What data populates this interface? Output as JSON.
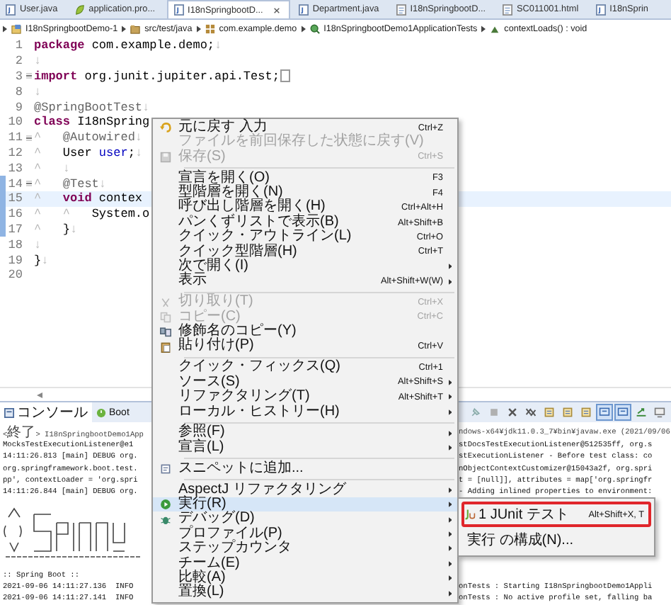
{
  "editor_tabs": [
    {
      "label": "User.java",
      "kind": "java",
      "selected": false
    },
    {
      "label": "application.pro...",
      "kind": "properties",
      "selected": false
    },
    {
      "label": "I18nSpringbootD...",
      "kind": "java",
      "selected": true
    },
    {
      "label": "Department.java",
      "kind": "java",
      "selected": false
    },
    {
      "label": "I18nSpringbootD...",
      "kind": "html",
      "selected": false
    },
    {
      "label": "SC011001.html",
      "kind": "html",
      "selected": false
    },
    {
      "label": "I18nSprin",
      "kind": "java",
      "selected": false
    }
  ],
  "breadcrumb": [
    {
      "label": "I18nSpringbootDemo-1",
      "kind": "project"
    },
    {
      "label": "src/test/java",
      "kind": "folder"
    },
    {
      "label": "com.example.demo",
      "kind": "package"
    },
    {
      "label": "I18nSpringbootDemo1ApplicationTests",
      "kind": "class"
    },
    {
      "label": "contextLoads() : void",
      "kind": "method"
    }
  ],
  "code_lines": [
    {
      "number": "1",
      "fold": false,
      "marked": false,
      "current": false,
      "collapsed": false,
      "tokens": [
        {
          "kind": "keyword",
          "text": "package"
        },
        {
          "kind": "plain",
          "text": " com.example.demo;"
        },
        {
          "kind": "whitespace",
          "text": "↓"
        }
      ]
    },
    {
      "number": "2",
      "fold": false,
      "marked": false,
      "current": false,
      "collapsed": false,
      "tokens": [
        {
          "kind": "whitespace",
          "text": "↓"
        }
      ]
    },
    {
      "number": "3",
      "fold": true,
      "marked": false,
      "current": false,
      "collapsed": true,
      "tokens": [
        {
          "kind": "keyword",
          "text": "import"
        },
        {
          "kind": "plain",
          "text": " org.junit.jupiter.api.Test;"
        }
      ]
    },
    {
      "number": "8",
      "fold": false,
      "marked": false,
      "current": false,
      "collapsed": false,
      "tokens": [
        {
          "kind": "whitespace",
          "text": "↓"
        }
      ]
    },
    {
      "number": "9",
      "fold": false,
      "marked": false,
      "current": false,
      "collapsed": false,
      "tokens": [
        {
          "kind": "annotation",
          "text": "@SpringBootTest"
        },
        {
          "kind": "whitespace",
          "text": "↓"
        }
      ]
    },
    {
      "number": "10",
      "fold": false,
      "marked": false,
      "current": false,
      "collapsed": false,
      "tokens": [
        {
          "kind": "keyword",
          "text": "class"
        },
        {
          "kind": "plain",
          "text": " I18nSpring"
        }
      ]
    },
    {
      "number": "11",
      "fold": true,
      "marked": false,
      "current": false,
      "collapsed": false,
      "tokens": [
        {
          "kind": "whitespace",
          "text": "^   "
        },
        {
          "kind": "annotation",
          "text": "@Autowired"
        },
        {
          "kind": "whitespace",
          "text": "↓"
        }
      ]
    },
    {
      "number": "12",
      "fold": false,
      "marked": false,
      "current": false,
      "collapsed": false,
      "tokens": [
        {
          "kind": "whitespace",
          "text": "^   "
        },
        {
          "kind": "plain",
          "text": "User "
        },
        {
          "kind": "field",
          "text": "user"
        },
        {
          "kind": "plain",
          "text": ";"
        },
        {
          "kind": "whitespace",
          "text": "↓"
        }
      ]
    },
    {
      "number": "13",
      "fold": false,
      "marked": false,
      "current": false,
      "collapsed": false,
      "tokens": [
        {
          "kind": "whitespace",
          "text": "^   ↓"
        }
      ]
    },
    {
      "number": "14",
      "fold": true,
      "marked": true,
      "current": false,
      "collapsed": false,
      "tokens": [
        {
          "kind": "whitespace",
          "text": "^   "
        },
        {
          "kind": "annotation",
          "text": "@Test"
        },
        {
          "kind": "whitespace",
          "text": "↓"
        }
      ]
    },
    {
      "number": "15",
      "fold": false,
      "marked": true,
      "current": true,
      "collapsed": false,
      "tokens": [
        {
          "kind": "whitespace",
          "text": "^   "
        },
        {
          "kind": "keyword",
          "text": "void"
        },
        {
          "kind": "plain",
          "text": " contex"
        }
      ]
    },
    {
      "number": "16",
      "fold": false,
      "marked": true,
      "current": false,
      "collapsed": false,
      "tokens": [
        {
          "kind": "whitespace",
          "text": "^   ^   "
        },
        {
          "kind": "plain",
          "text": "System.o"
        }
      ]
    },
    {
      "number": "17",
      "fold": false,
      "marked": true,
      "current": false,
      "collapsed": false,
      "tokens": [
        {
          "kind": "whitespace",
          "text": "^   "
        },
        {
          "kind": "plain",
          "text": "}"
        },
        {
          "kind": "whitespace",
          "text": "↓"
        }
      ]
    },
    {
      "number": "18",
      "fold": false,
      "marked": false,
      "current": false,
      "collapsed": false,
      "tokens": [
        {
          "kind": "whitespace",
          "text": "↓"
        }
      ]
    },
    {
      "number": "19",
      "fold": false,
      "marked": false,
      "current": false,
      "collapsed": false,
      "tokens": [
        {
          "kind": "plain",
          "text": "}"
        },
        {
          "kind": "whitespace",
          "text": "↓"
        }
      ]
    },
    {
      "number": "20",
      "fold": false,
      "marked": false,
      "current": false,
      "collapsed": false
    }
  ],
  "console": {
    "tabs": [
      {
        "label": "コンソール",
        "kind": "console",
        "selected": true
      },
      {
        "label": "Boot",
        "kind": "boot",
        "selected": false
      }
    ],
    "toolbar": [
      {
        "kind": "pin",
        "pressed": false
      },
      {
        "kind": "stop",
        "pressed": false
      },
      {
        "kind": "remove",
        "pressed": false
      },
      {
        "kind": "remove-all",
        "pressed": false
      },
      {
        "kind": "page",
        "pressed": false
      },
      {
        "kind": "page",
        "pressed": false
      },
      {
        "kind": "page",
        "pressed": false
      },
      {
        "kind": "display",
        "pressed": true
      },
      {
        "kind": "display",
        "pressed": true
      },
      {
        "kind": "open",
        "pressed": false
      },
      {
        "kind": "monitor",
        "pressed": false
      }
    ],
    "lines": [
      {
        "kind": "header",
        "left": "<終了> I18nSpringbootDemo1App",
        "right": "ndows-x64¥jdk11.0.3_7¥bin¥javaw.exe (2021/09/06"
      },
      {
        "kind": "text",
        "left": "MocksTestExecutionListener@e1",
        "right": "stDocsTestExecutionListener@512535ff, org.s"
      },
      {
        "kind": "text",
        "left": "14:11:26.813 [main] DEBUG org.",
        "right": "stExecutionListener - Before test class: co"
      },
      {
        "kind": "text",
        "left": "org.springframework.boot.test.",
        "right": "nObjectContextCustomizer@15043a2f, org.spri"
      },
      {
        "kind": "text",
        "left": "pp', contextLoader = 'org.spri",
        "right": "t = [null]], attributes = map['org.springfr"
      },
      {
        "kind": "text",
        "left": "14:11:26.844 [main] DEBUG org.",
        "right": "- Adding inlined properties to environment:"
      },
      {
        "kind": "banner"
      },
      {
        "kind": "text",
        "left": ":: Spring Boot ::"
      },
      {
        "kind": "text",
        "left": "2021-09-06 14:11:27.136  INFO",
        "right": "onTests : Starting I18nSpringbootDemo1Appli"
      },
      {
        "kind": "text",
        "left": "2021-09-06 14:11:27.141  INFO",
        "right": "onTests : No active profile set, falling ba"
      }
    ]
  },
  "context_menu": {
    "items": [
      {
        "kind": "item",
        "label": "元に戻す 入力",
        "shortcut": "Ctrl+Z",
        "disabled": false,
        "submenu": false,
        "selected": false
      },
      {
        "kind": "item",
        "label": "ファイルを前回保存した状態に戻す(V)",
        "disabled": true,
        "submenu": false,
        "selected": false
      },
      {
        "kind": "item",
        "label": "保存(S)",
        "shortcut": "Ctrl+S",
        "disabled": true,
        "submenu": false,
        "selected": false
      },
      {
        "kind": "separator"
      },
      {
        "kind": "item",
        "label": "宣言を開く(O)",
        "shortcut": "F3",
        "disabled": false,
        "submenu": false,
        "selected": false
      },
      {
        "kind": "item",
        "label": "型階層を開く(N)",
        "shortcut": "F4",
        "disabled": false,
        "submenu": false,
        "selected": false
      },
      {
        "kind": "item",
        "label": "呼び出し階層を開く(H)",
        "shortcut": "Ctrl+Alt+H",
        "disabled": false,
        "submenu": false,
        "selected": false
      },
      {
        "kind": "item",
        "label": "パンくずリストで表示(B)",
        "shortcut": "Alt+Shift+B",
        "disabled": false,
        "submenu": false,
        "selected": false
      },
      {
        "kind": "item",
        "label": "クイック・アウトライン(L)",
        "shortcut": "Ctrl+O",
        "disabled": false,
        "submenu": false,
        "selected": false
      },
      {
        "kind": "item",
        "label": "クイック型階層(H)",
        "shortcut": "Ctrl+T",
        "disabled": false,
        "submenu": false,
        "selected": false
      },
      {
        "kind": "item",
        "label": "次で開く(I)",
        "disabled": false,
        "submenu": true,
        "selected": false
      },
      {
        "kind": "item",
        "label": "表示",
        "shortcut": "Alt+Shift+W(W)",
        "disabled": false,
        "submenu": true,
        "selected": false
      },
      {
        "kind": "separator"
      },
      {
        "kind": "item",
        "label": "切り取り(T)",
        "shortcut": "Ctrl+X",
        "disabled": true,
        "submenu": false,
        "selected": false
      },
      {
        "kind": "item",
        "label": "コピー(C)",
        "shortcut": "Ctrl+C",
        "disabled": true,
        "submenu": false,
        "selected": false
      },
      {
        "kind": "item",
        "label": "修飾名のコピー(Y)",
        "disabled": false,
        "submenu": false,
        "selected": false
      },
      {
        "kind": "item",
        "label": "貼り付け(P)",
        "shortcut": "Ctrl+V",
        "disabled": false,
        "submenu": false,
        "selected": false
      },
      {
        "kind": "separator"
      },
      {
        "kind": "item",
        "label": "クイック・フィックス(Q)",
        "shortcut": "Ctrl+1",
        "disabled": false,
        "submenu": false,
        "selected": false
      },
      {
        "kind": "item",
        "label": "ソース(S)",
        "shortcut": "Alt+Shift+S",
        "disabled": false,
        "submenu": true,
        "selected": false
      },
      {
        "kind": "item",
        "label": "リファクタリング(T)",
        "shortcut": "Alt+Shift+T",
        "disabled": false,
        "submenu": true,
        "selected": false
      },
      {
        "kind": "item",
        "label": "ローカル・ヒストリー(H)",
        "disabled": false,
        "submenu": true,
        "selected": false
      },
      {
        "kind": "separator"
      },
      {
        "kind": "item",
        "label": "参照(F)",
        "disabled": false,
        "submenu": true,
        "selected": false
      },
      {
        "kind": "item",
        "label": "宣言(L)",
        "disabled": false,
        "submenu": true,
        "selected": false
      },
      {
        "kind": "separator"
      },
      {
        "kind": "item",
        "label": "スニペットに追加...",
        "disabled": false,
        "submenu": false,
        "selected": false
      },
      {
        "kind": "separator"
      },
      {
        "kind": "item",
        "label": "AspectJ リファクタリング",
        "disabled": false,
        "submenu": true,
        "selected": false
      },
      {
        "kind": "item",
        "label": "実行(R)",
        "disabled": false,
        "submenu": true,
        "selected": true
      },
      {
        "kind": "item",
        "label": "デバッグ(D)",
        "disabled": false,
        "submenu": true,
        "selected": false
      },
      {
        "kind": "item",
        "label": "プロファイル(P)",
        "disabled": false,
        "submenu": true,
        "selected": false
      },
      {
        "kind": "item",
        "label": "ステップカウンタ",
        "disabled": false,
        "submenu": true,
        "selected": false
      },
      {
        "kind": "item",
        "label": "チーム(E)",
        "disabled": false,
        "submenu": true,
        "selected": false
      },
      {
        "kind": "item",
        "label": "比較(A)",
        "disabled": false,
        "submenu": true,
        "selected": false
      },
      {
        "kind": "item",
        "label": "置換(L)",
        "disabled": false,
        "submenu": true,
        "selected": false
      }
    ]
  },
  "run_submenu": {
    "items": [
      {
        "label": "1 JUnit テスト",
        "shortcut": "Alt+Shift+X, T",
        "selected": true
      },
      {
        "label": "実行 の構成(N)...",
        "selected": false
      }
    ]
  }
}
